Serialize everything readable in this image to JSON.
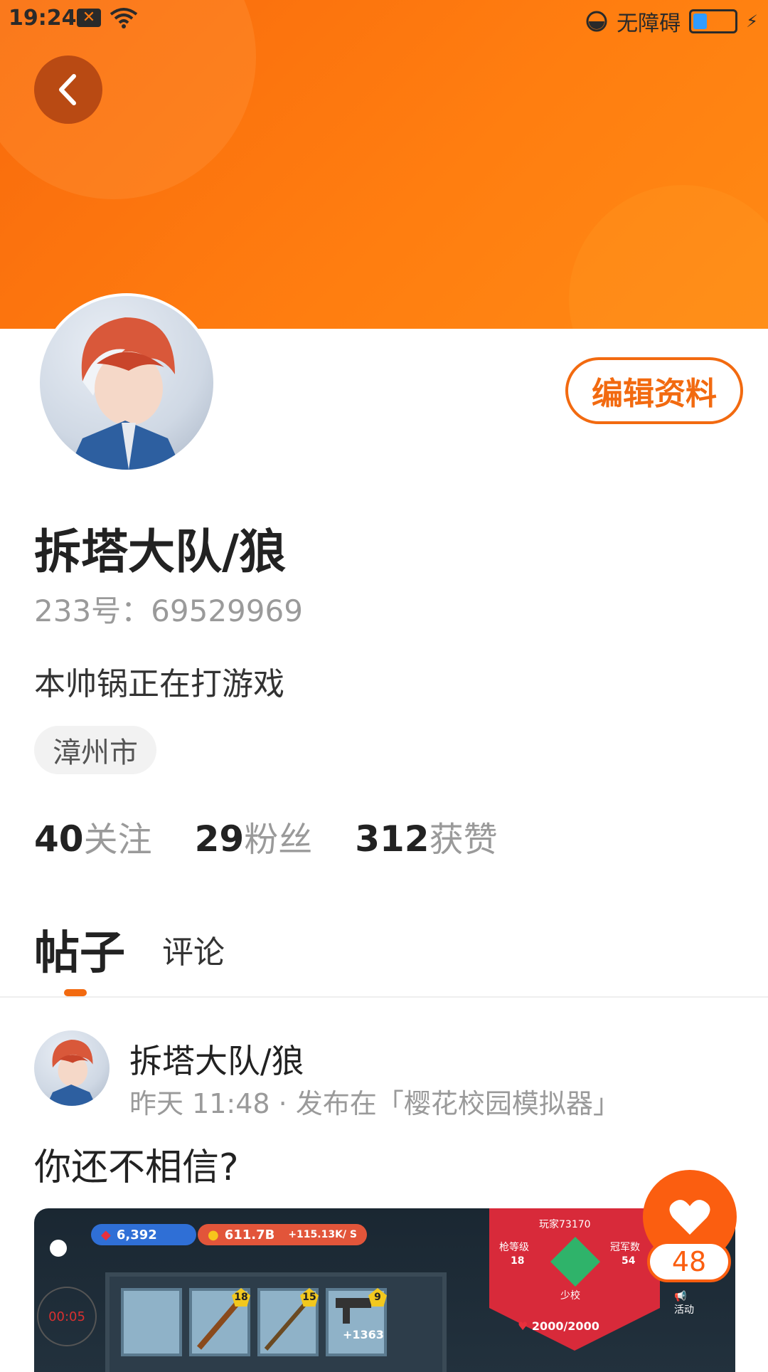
{
  "status_bar": {
    "time": "19:24",
    "accessibility": "无障碍"
  },
  "profile": {
    "edit_button": "编辑资料",
    "username": "拆塔大队/狼",
    "uid": "233号：69529969",
    "bio": "本帅锅正在打游戏",
    "location": "漳州市",
    "stats": [
      {
        "num": "40",
        "label": "关注"
      },
      {
        "num": "29",
        "label": "粉丝"
      },
      {
        "num": "312",
        "label": "获赞"
      }
    ]
  },
  "tabs": {
    "posts": "帖子",
    "comments": "评论"
  },
  "post": {
    "author": "拆塔大队/狼",
    "meta": "昨天 11:48 · 发布在「樱花校园模拟器」",
    "title": "你还不相信?",
    "game": {
      "gems": "6,392",
      "coins": "611.7B",
      "rate": "+115.13K/ S",
      "player": "玩家73170",
      "gun_level_label": "枪等级",
      "champion_label": "冠军数",
      "rank": "少校",
      "gun_level": "18",
      "champions": "54",
      "health": "2000/2000",
      "slot_badges": [
        "18",
        "15",
        "9"
      ],
      "bonus": "+1363",
      "activity": "活动",
      "timer": "00:05"
    }
  },
  "like": {
    "count": "48"
  },
  "colors": {
    "accent": "#f26a10",
    "like": "#fb5e10",
    "banner": "#ff7d10"
  }
}
